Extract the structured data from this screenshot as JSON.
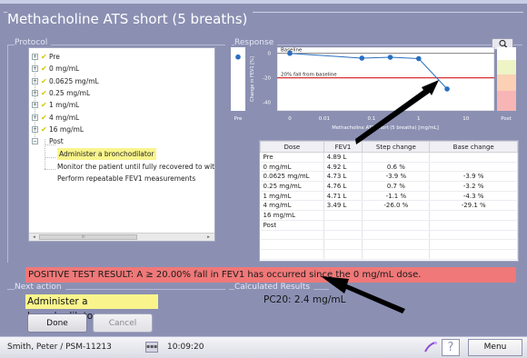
{
  "window": {
    "title": "Methacholine ATS short (5 breaths)"
  },
  "protocol": {
    "label": "Protocol",
    "items": [
      {
        "label": "Pre",
        "expander": "+"
      },
      {
        "label": "0 mg/mL",
        "expander": "+"
      },
      {
        "label": "0.0625 mg/mL",
        "expander": "+"
      },
      {
        "label": "0.25 mg/mL",
        "expander": "+"
      },
      {
        "label": "1 mg/mL",
        "expander": "+"
      },
      {
        "label": "4 mg/mL",
        "expander": "+"
      },
      {
        "label": "16 mg/mL",
        "expander": "+"
      },
      {
        "label": "Post",
        "expander": "−"
      }
    ],
    "post_children": [
      "Administer a bronchodilator",
      "Monitor the patient until fully recovered to within",
      "Perform repeatable FEV1 measurements"
    ],
    "scroll_arrow_left": "◂",
    "scroll_arrow_right": "▸",
    "scroll_grip": "III"
  },
  "response": {
    "label": "Response",
    "zoom_icon": "magnifier-icon"
  },
  "chart_data": {
    "type": "line",
    "title": "",
    "xlabel": "Methacholine ATS short (5 breaths) [mg/mL]",
    "ylabel": "Change in FEV1 [%]",
    "x_scale": "log",
    "xtick_labels": [
      "0",
      "0.01",
      "0.1",
      "1",
      "10"
    ],
    "ytick_labels": [
      "0",
      "-20",
      "-40"
    ],
    "ylim": [
      -47,
      5
    ],
    "pre_label": "Pre",
    "post_label": "Post",
    "baseline_label": "Baseline",
    "threshold_label": "20% fall from baseline",
    "threshold_value": -20,
    "pre_point": 0,
    "series": [
      {
        "x": [
          "0",
          "0.0625",
          "0.25",
          "1",
          "4"
        ],
        "values": [
          0,
          -3.9,
          -3.2,
          -4.3,
          -29.1
        ]
      }
    ],
    "colors": {
      "series": "#2a6fc0",
      "threshold": "#d83030",
      "baseline": "#555555"
    }
  },
  "table": {
    "columns": [
      "Dose",
      "FEV1",
      "Step change",
      "Base change"
    ],
    "rows": [
      [
        "Pre",
        "4.89 L",
        "",
        ""
      ],
      [
        "0 mg/mL",
        "4.92 L",
        "0.6 %",
        ""
      ],
      [
        "0.0625 mg/mL",
        "4.73 L",
        "-3.9 %",
        "-3.9 %"
      ],
      [
        "0.25 mg/mL",
        "4.76 L",
        "0.7 %",
        "-3.2 %"
      ],
      [
        "1 mg/mL",
        "4.71 L",
        "-1.1 %",
        "-4.3 %"
      ],
      [
        "4 mg/mL",
        "3.49 L",
        "-26.0 %",
        "-29.1 %"
      ],
      [
        "16 mg/mL",
        "",
        "",
        ""
      ],
      [
        "Post",
        "",
        "",
        ""
      ],
      [
        "",
        "",
        "",
        ""
      ],
      [
        "",
        "",
        "",
        ""
      ],
      [
        "",
        "",
        "",
        ""
      ]
    ]
  },
  "result_banner": "POSITIVE TEST RESULT: A ≥ 20.00% fall in FEV1 has occurred since the 0 mg/mL dose.",
  "next_action": {
    "label": "Next action",
    "value": "Administer a bronchodilator"
  },
  "calculated_results": {
    "label": "Calculated Results",
    "value": "PC20: 2.4 mg/mL"
  },
  "buttons": {
    "done": "Done",
    "cancel": "Cancel"
  },
  "statusbar": {
    "patient": "Smith, Peter / PSM-11213",
    "keyboard": "▪▪▪",
    "time": "10:09:20",
    "help": "?",
    "menu": "Menu"
  },
  "colors": {
    "background": "#8b90b3",
    "banner": "#f07878",
    "highlight": "#f9f58c"
  }
}
